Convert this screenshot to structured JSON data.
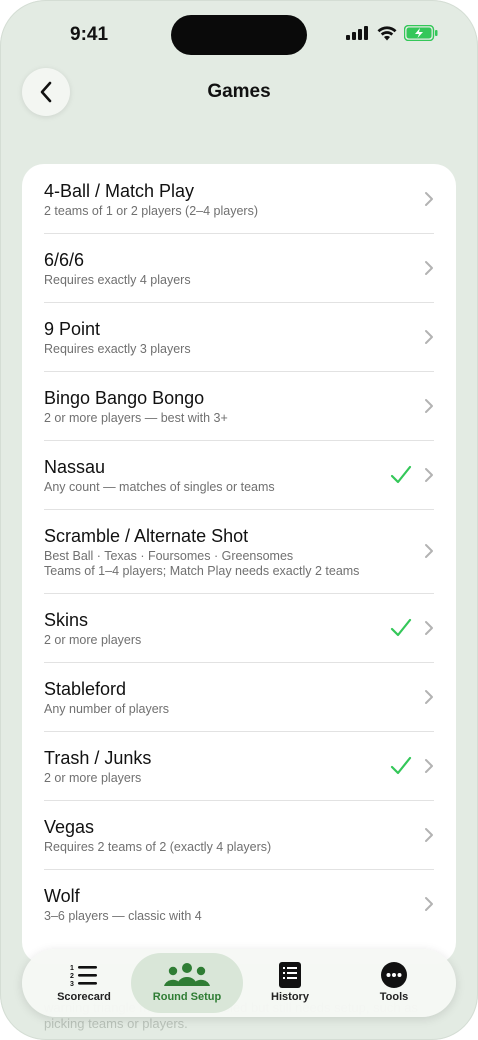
{
  "status_bar": {
    "time": "9:41",
    "icons": [
      "cellular-signal-icon",
      "wifi-icon",
      "battery-charging-icon"
    ],
    "battery_color": "#34c759"
  },
  "header": {
    "back_icon": "chevron-left-icon",
    "title": "Games"
  },
  "games": [
    {
      "title": "4-Ball / Match Play",
      "subtitle": "2 teams of 1 or 2 players (2–4 players)",
      "selected": false
    },
    {
      "title": "6/6/6",
      "subtitle": "Requires exactly 4 players",
      "selected": false
    },
    {
      "title": "9 Point",
      "subtitle": "Requires exactly 3 players",
      "selected": false
    },
    {
      "title": "Bingo Bango Bongo",
      "subtitle": "2 or more players — best with 3+",
      "selected": false
    },
    {
      "title": "Nassau",
      "subtitle": "Any count — matches of singles or teams",
      "selected": true
    },
    {
      "title": "Scramble / Alternate Shot",
      "subtitle": "Best Ball · Texas · Foursomes · Greensomes",
      "subtitle2": "Teams of 1–4 players; Match Play needs exactly 2 teams",
      "selected": false
    },
    {
      "title": "Skins",
      "subtitle": "2 or more players",
      "selected": true
    },
    {
      "title": "Stableford",
      "subtitle": "Any number of players",
      "selected": false
    },
    {
      "title": "Trash / Junks",
      "subtitle": "2 or more players",
      "selected": true
    },
    {
      "title": "Vegas",
      "subtitle": "Requires 2 teams of 2 (exactly 4 players)",
      "selected": false
    },
    {
      "title": "Wolf",
      "subtitle": "3–6 players — classic with 4",
      "selected": false
    }
  ],
  "colors": {
    "check": "#34c759",
    "accent": "#2f7d34",
    "background": "#e3ebe3"
  },
  "ghost_text": "warning triangle means it's enabled but still needs setup, such as picking teams or players.",
  "tabbar": {
    "tabs": [
      {
        "label": "Scorecard",
        "icon": "numbered-list-icon",
        "active": false
      },
      {
        "label": "Round Setup",
        "icon": "group-people-icon",
        "active": true
      },
      {
        "label": "History",
        "icon": "notebook-icon",
        "active": false
      },
      {
        "label": "Tools",
        "icon": "more-ellipsis-icon",
        "active": false
      }
    ]
  }
}
